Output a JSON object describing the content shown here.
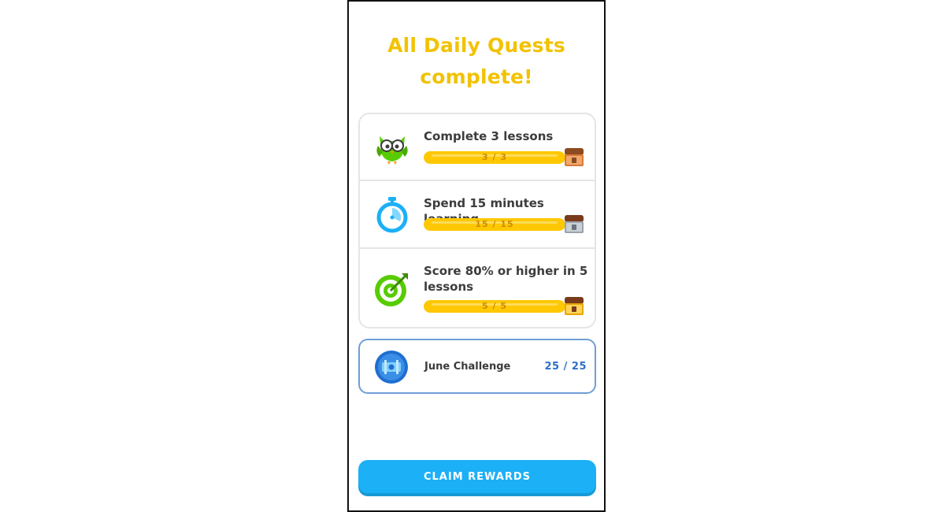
{
  "header": {
    "title_line1": "All Daily Quests",
    "title_line2": "complete!"
  },
  "quests": [
    {
      "title": "Complete 3 lessons",
      "progress_text": "3 / 3",
      "progress": 1.0,
      "icon": "owl-icon",
      "reward_icon": "chest-icon"
    },
    {
      "title": "Spend 15 minutes learning",
      "progress_text": "15 / 15",
      "progress": 1.0,
      "icon": "stopwatch-icon",
      "reward_icon": "chest-icon"
    },
    {
      "title": "Score 80% or higher in 5 lessons",
      "progress_text": "5 / 5",
      "progress": 1.0,
      "icon": "target-icon",
      "reward_icon": "chest-icon"
    }
  ],
  "challenge": {
    "name": "June Challenge",
    "progress_text": "25 / 25",
    "icon": "monthly-badge-icon"
  },
  "actions": {
    "claim_label": "CLAIM REWARDS"
  },
  "colors": {
    "title_yellow": "#f2c200",
    "bar_fill": "#ffc800",
    "bar_text": "#cc8b00",
    "primary_button": "#1cb0f6",
    "challenge_border": "#6e9ed6",
    "challenge_text": "#2b70c9"
  }
}
